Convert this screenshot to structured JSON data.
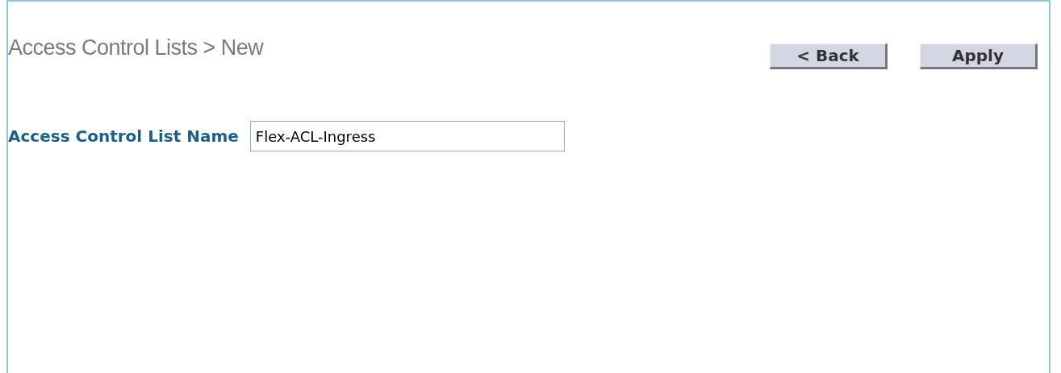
{
  "page": {
    "title": "Access Control Lists > New"
  },
  "buttons": [
    {
      "label": "< Back"
    },
    {
      "label": "Apply"
    }
  ],
  "form": {
    "label": "Access Control List Name",
    "value": "Flex-ACL-Ingress"
  }
}
